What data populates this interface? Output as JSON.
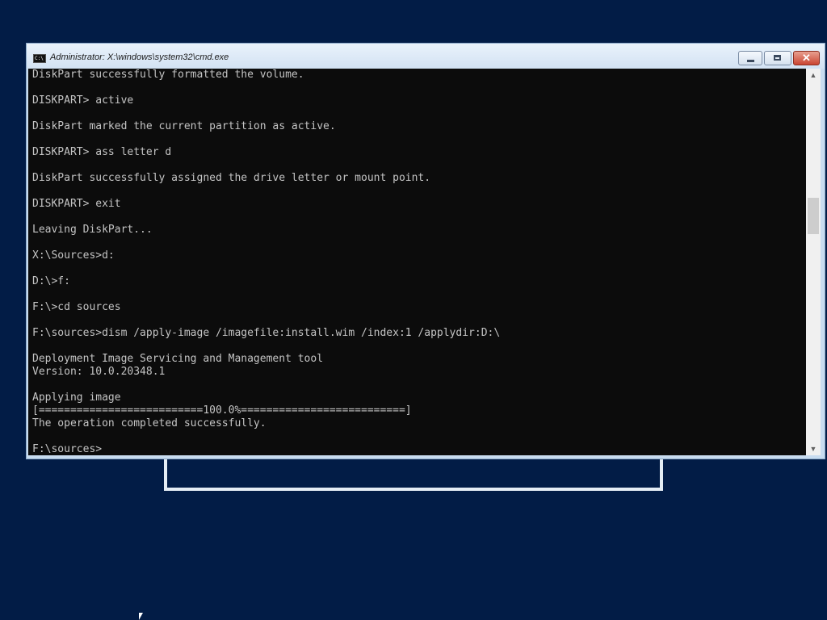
{
  "window": {
    "title": "Administrator: X:\\windows\\system32\\cmd.exe",
    "icon": "cmd-icon",
    "icon_glyph": "C:\\"
  },
  "controls": {
    "minimize_icon": "minimize-icon",
    "maximize_icon": "maximize-icon",
    "close_icon": "close-icon",
    "close_glyph": "✕"
  },
  "console": {
    "lines": [
      "DiskPart successfully formatted the volume.",
      "",
      "DISKPART> active",
      "",
      "DiskPart marked the current partition as active.",
      "",
      "DISKPART> ass letter d",
      "",
      "DiskPart successfully assigned the drive letter or mount point.",
      "",
      "DISKPART> exit",
      "",
      "Leaving DiskPart...",
      "",
      "X:\\Sources>d:",
      "",
      "D:\\>f:",
      "",
      "F:\\>cd sources",
      "",
      "F:\\sources>dism /apply-image /imagefile:install.wim /index:1 /applydir:D:\\",
      "",
      "Deployment Image Servicing and Management tool",
      "Version: 10.0.20348.1",
      "",
      "Applying image",
      "[==========================100.0%==========================]",
      "The operation completed successfully.",
      "",
      "F:\\sources>"
    ]
  },
  "scrollbar": {
    "up_glyph": "▲",
    "down_glyph": "▼"
  },
  "colors": {
    "desktop": "#021c46",
    "console_bg": "#0c0c0c",
    "console_text": "#c4c4c4"
  }
}
